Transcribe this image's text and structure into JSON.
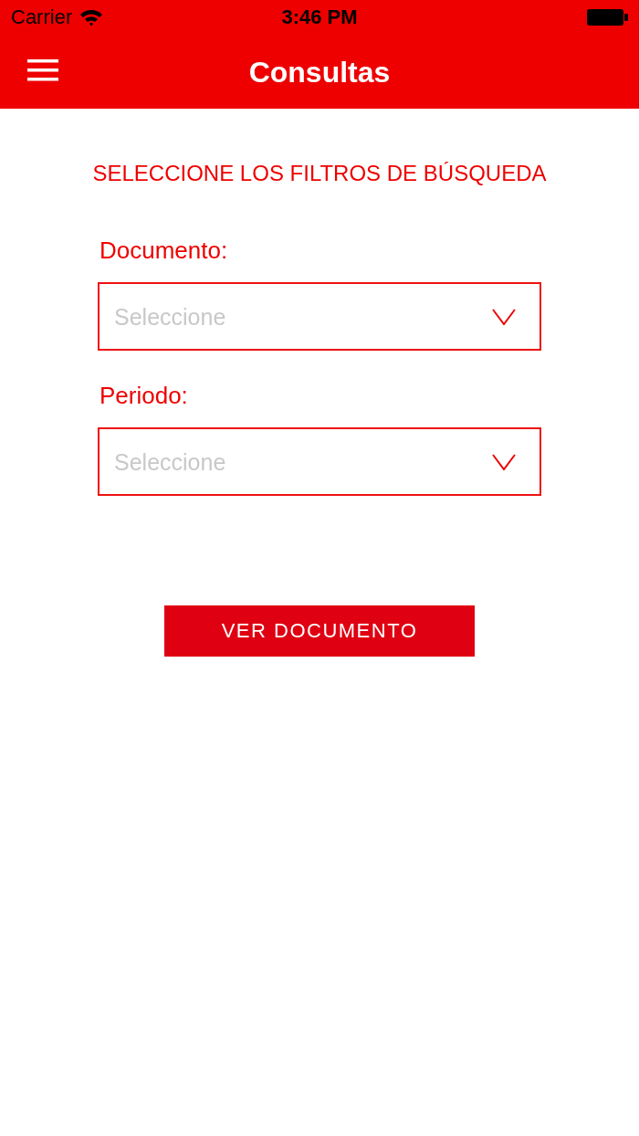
{
  "status_bar": {
    "carrier": "Carrier",
    "time": "3:46 PM"
  },
  "nav_bar": {
    "title": "Consultas"
  },
  "heading": "SELECCIONE LOS FILTROS DE BÚSQUEDA",
  "filters": [
    {
      "label": "Documento:",
      "placeholder": "Seleccione"
    },
    {
      "label": "Periodo:",
      "placeholder": "Seleccione"
    }
  ],
  "button": {
    "label": "VER DOCUMENTO"
  }
}
